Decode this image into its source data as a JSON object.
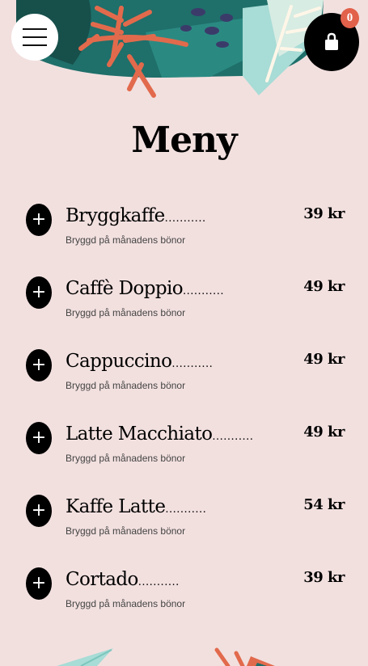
{
  "header": {
    "menu_icon": "hamburger-icon",
    "cart_icon": "shopping-bag-icon",
    "cart_count": "0",
    "accent_color": "#e2614a"
  },
  "page": {
    "title": "Meny",
    "background_color": "#f2e0df"
  },
  "menu": {
    "items": [
      {
        "add_label": "+",
        "name": "Bryggkaffe",
        "dots": "...........",
        "description": "Bryggd på månadens bönor",
        "price": "39 kr"
      },
      {
        "add_label": "+",
        "name": "Caffè Doppio",
        "dots": "...........",
        "description": "Bryggd på månadens bönor",
        "price": "49 kr"
      },
      {
        "add_label": "+",
        "name": "Cappuccino",
        "dots": "...........",
        "description": "Bryggd på månadens bönor",
        "price": "49 kr"
      },
      {
        "add_label": "+",
        "name": "Latte Macchiato",
        "dots": "...........",
        "description": "Bryggd på månadens bönor",
        "price": "49 kr"
      },
      {
        "add_label": "+",
        "name": "Kaffe Latte",
        "dots": "...........",
        "description": "Bryggd på månadens bönor",
        "price": "54 kr"
      },
      {
        "add_label": "+",
        "name": "Cortado",
        "dots": "...........",
        "description": "Bryggd på månadens bönor",
        "price": "39 kr"
      }
    ]
  }
}
